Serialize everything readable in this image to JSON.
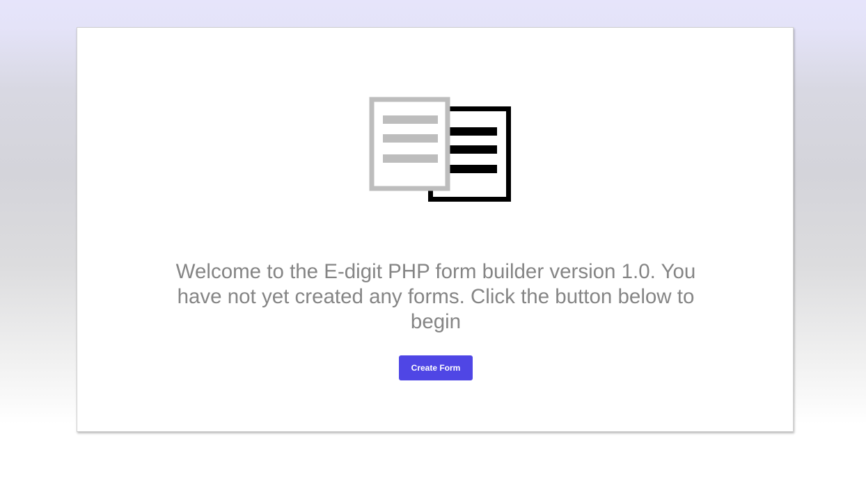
{
  "empty_state": {
    "icon": "documents-icon",
    "message": "Welcome to the E-digit PHP form builder version 1.0. You have not yet created any forms. Click the button below to begin",
    "create_button_label": "Create Form"
  },
  "colors": {
    "accent": "#4f46e5",
    "message_text": "#858585",
    "front_document": "#bdbdbd",
    "back_document": "#000000"
  }
}
